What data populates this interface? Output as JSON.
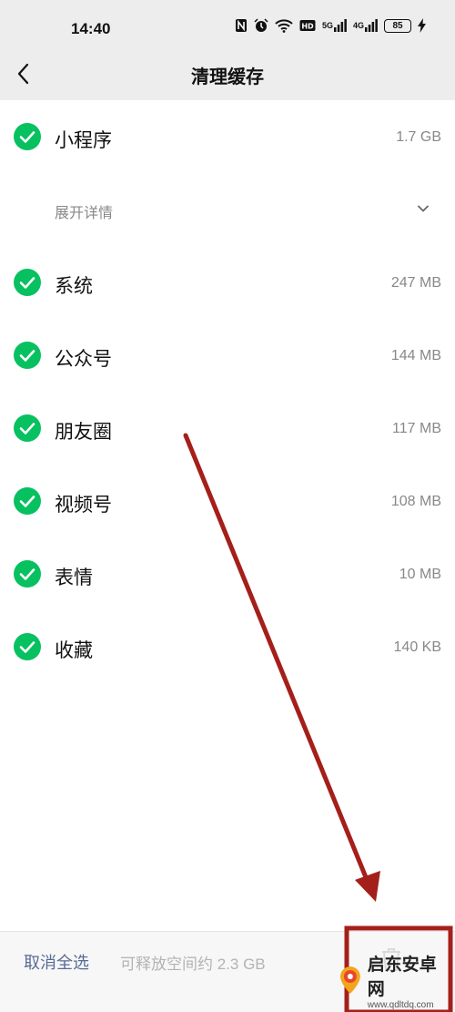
{
  "status": {
    "time": "14:40",
    "network_a": "5G",
    "network_b": "4G",
    "battery": "85"
  },
  "nav": {
    "title": "清理缓存"
  },
  "items": [
    {
      "label": "小程序",
      "size": "1.7 GB"
    },
    {
      "label": "系统",
      "size": "247 MB"
    },
    {
      "label": "公众号",
      "size": "144 MB"
    },
    {
      "label": "朋友圈",
      "size": "117 MB"
    },
    {
      "label": "视频号",
      "size": "108 MB"
    },
    {
      "label": "表情",
      "size": "10 MB"
    },
    {
      "label": "收藏",
      "size": "140 KB"
    }
  ],
  "expand": {
    "label": "展开详情"
  },
  "bottom": {
    "deselect_label": "取消全选",
    "free_space_text": "可释放空间约 2.3 GB"
  },
  "watermark": {
    "title": "启东安卓网",
    "url": "www.qdltdq.com"
  },
  "colors": {
    "check_green": "#07c160",
    "annotation_red": "#a51f1a",
    "link_blue": "#576b95"
  }
}
